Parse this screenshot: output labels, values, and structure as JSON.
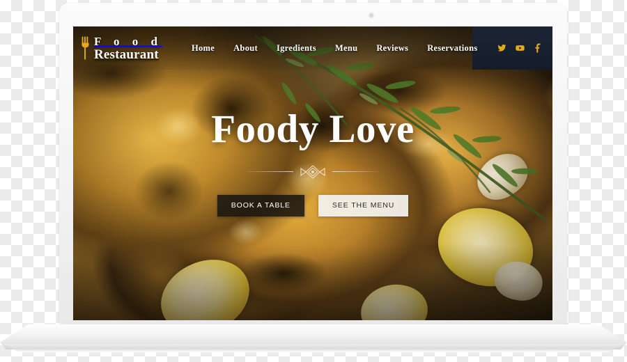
{
  "site": {
    "logo": {
      "icon": "fork-icon",
      "line1": "F o o d",
      "line2": "Restaurant"
    },
    "nav": [
      {
        "label": "Home"
      },
      {
        "label": "About"
      },
      {
        "label": "Igredients"
      },
      {
        "label": "Menu"
      },
      {
        "label": "Reviews"
      },
      {
        "label": "Reservations"
      }
    ],
    "social": [
      {
        "name": "twitter-icon",
        "label": "Twitter"
      },
      {
        "name": "youtube-icon",
        "label": "YouTube"
      },
      {
        "name": "facebook-icon",
        "label": "Facebook"
      }
    ],
    "hero": {
      "title": "Foody Love",
      "divider": "ornament-divider",
      "primary_button": "BOOK A TABLE",
      "secondary_button": "SEE THE MENU"
    }
  },
  "device": {
    "type": "laptop",
    "webcam": "webcam-dot"
  },
  "colors": {
    "accent_gold": "#e8a81c",
    "header_plate": "#17202e",
    "primary_button_bg": "#1a1610",
    "secondary_button_bg": "#f3f1ec",
    "text_light": "#ffffff",
    "device_shell": "#f3f3f3"
  }
}
